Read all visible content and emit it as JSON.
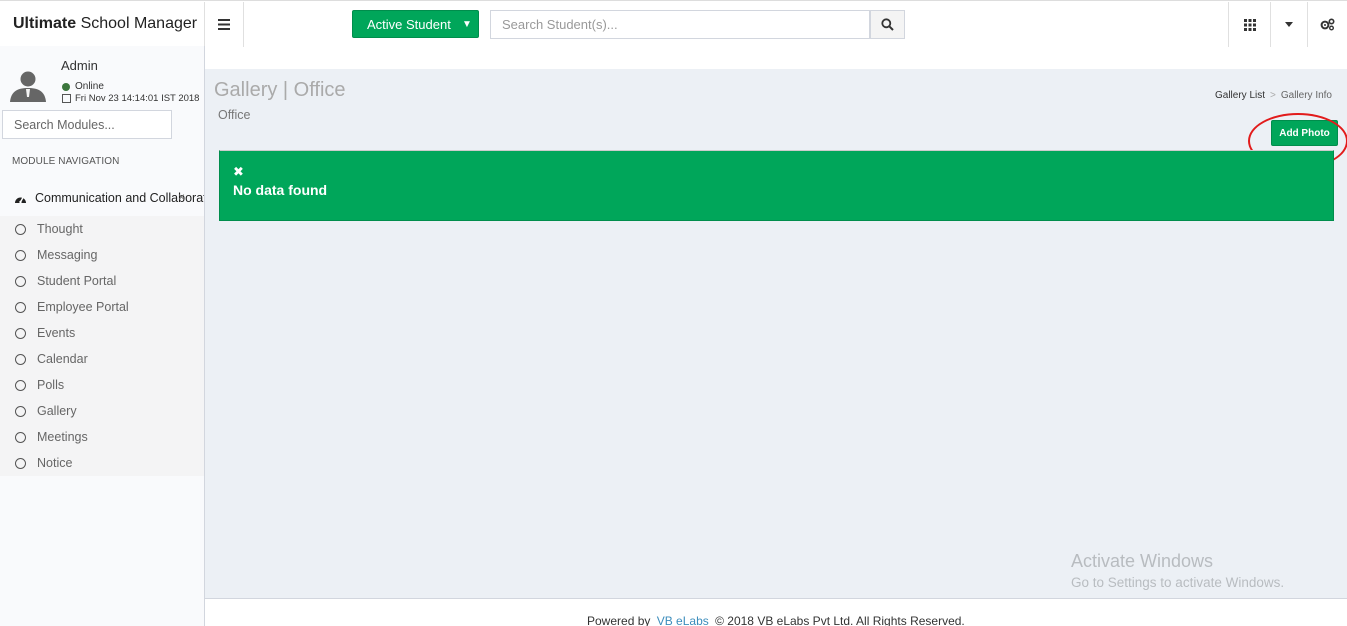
{
  "brand": {
    "bold": "Ultimate",
    "rest": "School Manager"
  },
  "topbar": {
    "active_student_label": "Active Student",
    "search_placeholder": "Search Student(s)..."
  },
  "user": {
    "name": "Admin",
    "status": "Online",
    "datetime": "Fri Nov 23 14:14:01 IST 2018"
  },
  "sidebar": {
    "search_placeholder": "Search Modules...",
    "nav_header": "MODULE NAVIGATION",
    "section": "Communication and Collaboration",
    "items": [
      {
        "label": "Thought"
      },
      {
        "label": "Messaging"
      },
      {
        "label": "Student Portal"
      },
      {
        "label": "Employee Portal"
      },
      {
        "label": "Events"
      },
      {
        "label": "Calendar"
      },
      {
        "label": "Polls"
      },
      {
        "label": "Gallery"
      },
      {
        "label": "Meetings"
      },
      {
        "label": "Notice"
      }
    ]
  },
  "page": {
    "title": "Gallery | Office",
    "subtitle": "Office",
    "breadcrumb": [
      "Gallery List",
      "Gallery Info"
    ],
    "breadcrumb_sep": ">",
    "add_photo_label": "Add Photo",
    "alert_close": "✖",
    "alert_text": "No data found"
  },
  "watermark": {
    "line1": "Activate Windows",
    "line2": "Go to Settings to activate Windows."
  },
  "footer": {
    "prefix": "Powered by",
    "link": "VB eLabs",
    "suffix": "© 2018 VB eLabs Pvt Ltd. All Rights Reserved."
  },
  "colors": {
    "primary_green": "#00a65a",
    "content_bg": "#ecf0f5",
    "sidebar_bg": "#f9fafc",
    "highlight_red": "#e21b1b"
  }
}
